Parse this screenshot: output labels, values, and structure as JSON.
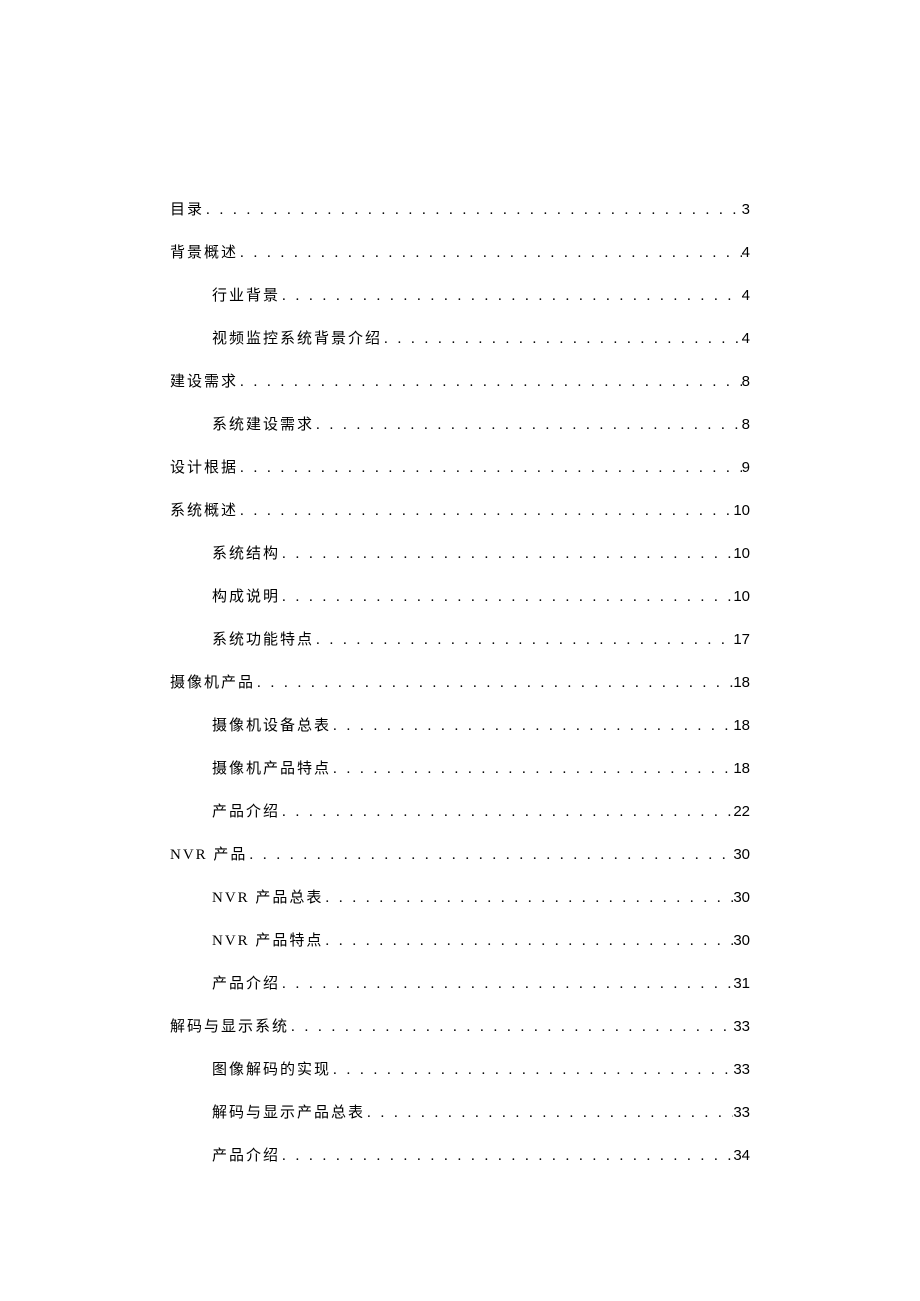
{
  "toc": [
    {
      "level": 1,
      "title": "目录",
      "page": "3"
    },
    {
      "level": 1,
      "title": "背景概述",
      "page": "4"
    },
    {
      "level": 2,
      "title": "行业背景",
      "page": "4"
    },
    {
      "level": 2,
      "title": "视频监控系统背景介绍",
      "page": "4"
    },
    {
      "level": 1,
      "title": "建设需求",
      "page": "8"
    },
    {
      "level": 2,
      "title": "系统建设需求",
      "page": "8"
    },
    {
      "level": 1,
      "title": "设计根据",
      "page": "9"
    },
    {
      "level": 1,
      "title": "系统概述",
      "page": "10"
    },
    {
      "level": 2,
      "title": "系统结构",
      "page": "10"
    },
    {
      "level": 2,
      "title": "构成说明",
      "page": "10"
    },
    {
      "level": 2,
      "title": "系统功能特点",
      "page": "17"
    },
    {
      "level": 1,
      "title": "摄像机产品",
      "page": "18"
    },
    {
      "level": 2,
      "title": "摄像机设备总表",
      "page": "18"
    },
    {
      "level": 2,
      "title": "摄像机产品特点",
      "page": "18"
    },
    {
      "level": 2,
      "title": "产品介绍",
      "page": "22"
    },
    {
      "level": 1,
      "title": "NVR 产品",
      "page": "30"
    },
    {
      "level": 2,
      "title": "NVR 产品总表",
      "page": "30"
    },
    {
      "level": 2,
      "title": "NVR 产品特点",
      "page": "30"
    },
    {
      "level": 2,
      "title": "产品介绍",
      "page": "31"
    },
    {
      "level": 1,
      "title": "解码与显示系统",
      "page": "33"
    },
    {
      "level": 2,
      "title": "图像解码的实现",
      "page": "33"
    },
    {
      "level": 2,
      "title": "解码与显示产品总表",
      "page": "33"
    },
    {
      "level": 2,
      "title": "产品介绍",
      "page": "34"
    }
  ],
  "dots": ". . . . . . . . . . . . . . . . . . . . . . . . . . . . . . . . . . . . . . . . . . . . . . . . . . . . . . . . . . . . . . . . . . . . . . . . . . . . . . . . . . . . . . . . . . . . . . . . . . . ."
}
